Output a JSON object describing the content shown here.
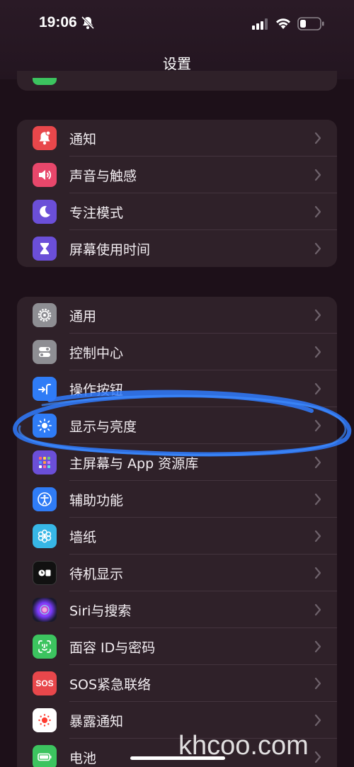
{
  "status_bar": {
    "time": "19:06",
    "icons": [
      "bell-off-icon",
      "signal-icon",
      "wifi-icon",
      "battery-icon"
    ]
  },
  "nav": {
    "title": "设置"
  },
  "groups": [
    {
      "items": [
        {
          "label": "通知",
          "icon": "bell-icon",
          "color": "#e8474b"
        },
        {
          "label": "声音与触感",
          "icon": "speaker-icon",
          "color": "#e8476b"
        },
        {
          "label": "专注模式",
          "icon": "moon-icon",
          "color": "#6b4fd8"
        },
        {
          "label": "屏幕使用时间",
          "icon": "hourglass-icon",
          "color": "#6b4fd8"
        }
      ]
    },
    {
      "items": [
        {
          "label": "通用",
          "icon": "gear-icon",
          "color": "#8e8e93"
        },
        {
          "label": "控制中心",
          "icon": "toggles-icon",
          "color": "#8e8e93"
        },
        {
          "label": "操作按钮",
          "icon": "action-button-icon",
          "color": "#2f7cf6"
        },
        {
          "label": "显示与亮度",
          "icon": "sun-icon",
          "color": "#2f7cf6"
        },
        {
          "label": "主屏幕与 App 资源库",
          "icon": "grid-icon",
          "color": "#6b4fd8"
        },
        {
          "label": "辅助功能",
          "icon": "accessibility-icon",
          "color": "#2f7cf6"
        },
        {
          "label": "墙纸",
          "icon": "flower-icon",
          "color": "#37b7e6"
        },
        {
          "label": "待机显示",
          "icon": "standby-icon",
          "color": "#111111"
        },
        {
          "label": "Siri与搜索",
          "icon": "siri-icon",
          "color": "#1a1a2e"
        },
        {
          "label": "面容 ID与密码",
          "icon": "faceid-icon",
          "color": "#3cc45f"
        },
        {
          "label": "SOS紧急联络",
          "icon": "sos-icon",
          "color": "#e8474b"
        },
        {
          "label": "暴露通知",
          "icon": "exposure-icon",
          "color": "#ffffff"
        },
        {
          "label": "电池",
          "icon": "battery-icon",
          "color": "#3cc45f"
        }
      ]
    }
  ],
  "sos_icon_text": "SOS",
  "watermark": "khcoo.com"
}
